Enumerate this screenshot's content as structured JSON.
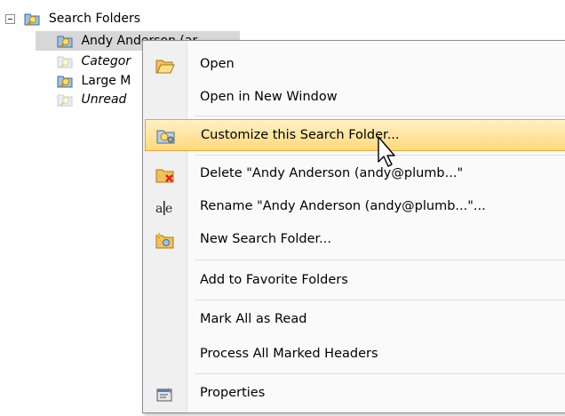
{
  "tree": {
    "root": {
      "label": "Search Folders",
      "expander": "minus-expander",
      "icon": "search-folder-icon"
    },
    "children": [
      {
        "label": "Andy Anderson (ar",
        "italic": false,
        "selected": true,
        "icon": "search-folder-icon"
      },
      {
        "label": "Categor",
        "italic": true,
        "selected": false,
        "icon": "search-folder-icon"
      },
      {
        "label": "Large M",
        "italic": false,
        "selected": false,
        "icon": "search-folder-icon"
      },
      {
        "label": "Unread",
        "italic": true,
        "selected": false,
        "icon": "search-folder-icon"
      }
    ]
  },
  "context_menu": {
    "items": [
      {
        "label": "Open",
        "icon": "open-folder-icon"
      },
      {
        "label": "Open in New Window",
        "icon": ""
      },
      {
        "label": "Customize this Search Folder...",
        "icon": "customize-search-folder-icon",
        "highlighted": true
      },
      {
        "label": "Delete \"Andy Anderson (andy@plumb...\"",
        "icon": "delete-folder-icon"
      },
      {
        "label": "Rename \"Andy Anderson (andy@plumb...\"...",
        "icon": "rename-icon"
      },
      {
        "label": "New Search Folder...",
        "icon": "new-search-folder-icon"
      },
      {
        "label": "Add to Favorite Folders",
        "icon": ""
      },
      {
        "label": "Mark All as Read",
        "icon": ""
      },
      {
        "label": "Process All Marked Headers",
        "icon": ""
      },
      {
        "label": "Properties",
        "icon": "properties-icon"
      }
    ]
  },
  "colors": {
    "highlight_top": "#fff0c5",
    "highlight_bottom": "#ffd97a",
    "highlight_border": "#e3a73b",
    "selection": "#d7d7d7"
  }
}
